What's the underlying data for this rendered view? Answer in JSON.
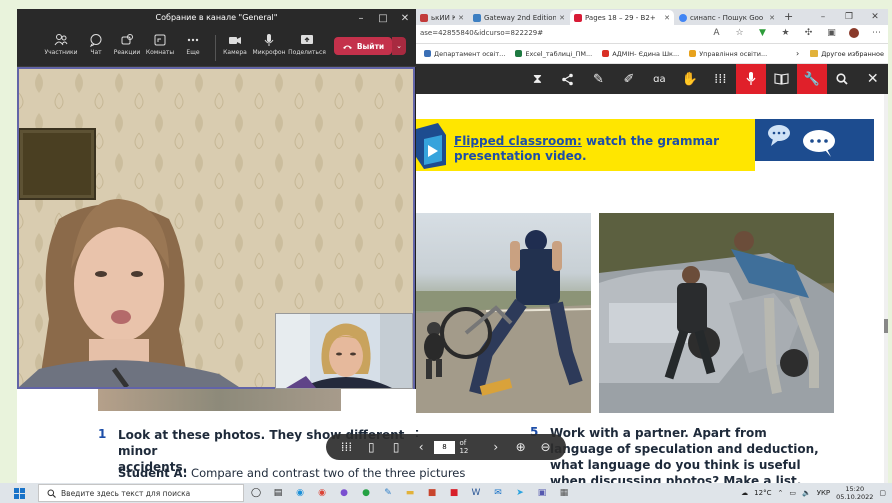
{
  "teams": {
    "title": "Собрание в канале \"General\"",
    "toolbar": {
      "participants": "Участники",
      "chat": "Чат",
      "reactions": "Реакции",
      "rooms": "Комнаты",
      "more": "Еще",
      "camera": "Камера",
      "mic": "Микрофон",
      "share": "Поделиться",
      "leave": "Выйти"
    }
  },
  "browser": {
    "tabs": [
      {
        "label": "ькИЙ К",
        "color": "#c23a3a",
        "active": false
      },
      {
        "label": "Gateway 2nd Edition",
        "color": "#3d7fc2",
        "active": false
      },
      {
        "label": "Pages 18 – 29 - B2+",
        "color": "#d81b36",
        "active": true
      },
      {
        "label": "синапс - Пошук Goo",
        "color": "#4285f4",
        "active": false
      }
    ],
    "url": "ase=42855840&idcurso=822229#",
    "bookmarks": [
      {
        "label": "Департамент освіт...",
        "color": "#3b6fb6"
      },
      {
        "label": "Excel_таблиці_ПМ...",
        "color": "#1e7a41"
      },
      {
        "label": "АДМІН- Єдина Шк...",
        "color": "#d93025"
      },
      {
        "label": "Управління освіти...",
        "color": "#e7a21c"
      }
    ],
    "other_bookmarks": "Другое избранное"
  },
  "page": {
    "banner_link": "Flipped classroom:",
    "banner_rest": " watch the grammar",
    "banner_line2": "presentation video.",
    "q1_num": "1",
    "q1_text": "Look at these photos. They show different minor",
    "q1_text2": "accidents.",
    "studentA_label": "Student A:",
    "studentA_text": " Compare and contrast two of the three pictures",
    "q5_num": "5",
    "q5_text": "Work with a partner. Apart from",
    "q5_text2": "language of speculation and deduction,",
    "q5_text3": "what language do you think is useful",
    "q5_text4": "when discussing photos? Make a list."
  },
  "pager": {
    "page": "8",
    "of": "of 12"
  },
  "taskbar": {
    "search_placeholder": "Введите здесь текст для поиска",
    "weather": "12°C",
    "lang": "УКР",
    "time": "15:20",
    "date": "05.10.2022"
  }
}
